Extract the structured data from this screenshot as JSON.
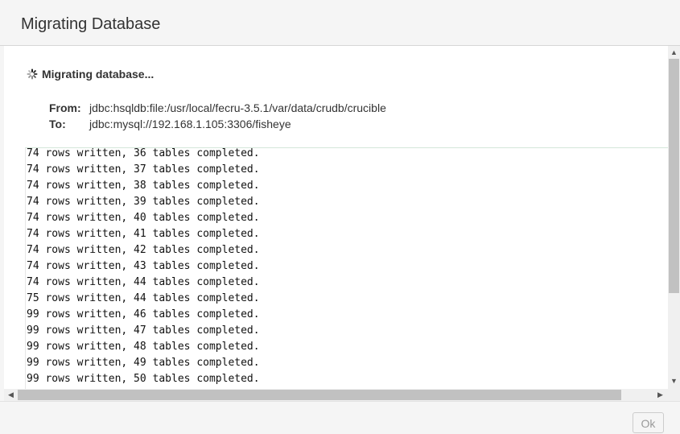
{
  "dialog": {
    "title": "Migrating Database",
    "status_text": "Migrating database...",
    "status_icon": "spinner-icon",
    "from_label": "From:",
    "from_value": "jdbc:hsqldb:file:/usr/local/fecru-3.5.1/var/data/crudb/crucible",
    "to_label": "To:",
    "to_value": "jdbc:mysql://192.168.1.105:3306/fisheye",
    "log_lines": [
      "74 rows written, 36 tables completed.",
      "74 rows written, 37 tables completed.",
      "74 rows written, 38 tables completed.",
      "74 rows written, 39 tables completed.",
      "74 rows written, 40 tables completed.",
      "74 rows written, 41 tables completed.",
      "74 rows written, 42 tables completed.",
      "74 rows written, 43 tables completed.",
      "74 rows written, 44 tables completed.",
      "75 rows written, 44 tables completed.",
      "99 rows written, 46 tables completed.",
      "99 rows written, 47 tables completed.",
      "99 rows written, 48 tables completed.",
      "99 rows written, 49 tables completed.",
      "99 rows written, 50 tables completed."
    ],
    "ok_label": "Ok"
  }
}
